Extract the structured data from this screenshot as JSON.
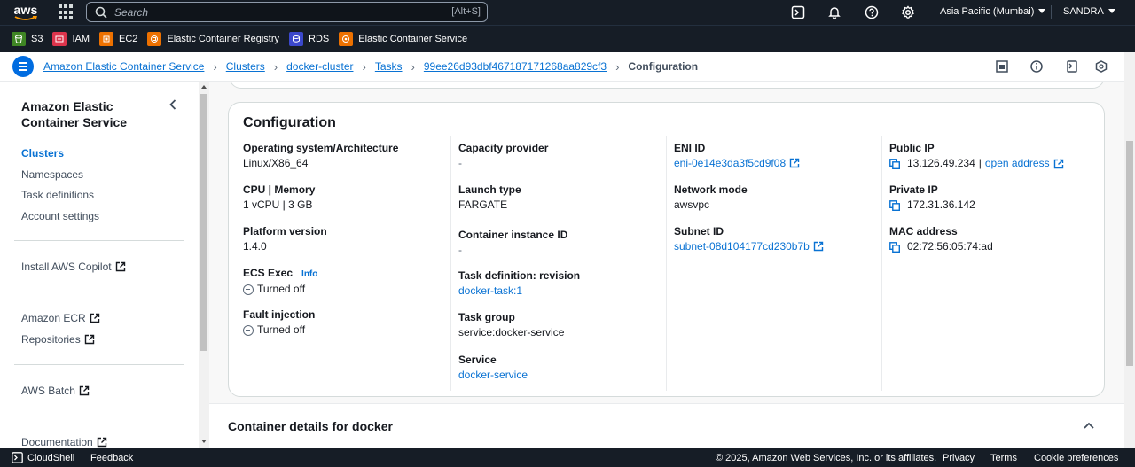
{
  "topnav": {
    "logo_text": "aws",
    "search_placeholder": "Search",
    "search_shortcut": "[Alt+S]",
    "region": "Asia Pacific (Mumbai)",
    "user": "SANDRA",
    "icons": [
      "cloudshell-icon",
      "bell-icon",
      "help-icon",
      "gear-icon"
    ]
  },
  "favorites": [
    {
      "label": "S3",
      "color": "#3f8624"
    },
    {
      "label": "IAM",
      "color": "#dd344c"
    },
    {
      "label": "EC2",
      "color": "#ed7100"
    },
    {
      "label": "Elastic Container Registry",
      "color": "#ed7100"
    },
    {
      "label": "RDS",
      "color": "#3b48cc"
    },
    {
      "label": "Elastic Container Service",
      "color": "#ed7100"
    }
  ],
  "breadcrumbs": {
    "items": [
      "Amazon Elastic Container Service",
      "Clusters",
      "docker-cluster",
      "Tasks",
      "99ee26d93dbf467187171268aa829cf3"
    ],
    "current": "Configuration"
  },
  "sidenav": {
    "title": "Amazon Elastic Container Service",
    "items": [
      "Clusters",
      "Namespaces",
      "Task definitions",
      "Account settings"
    ],
    "copilot": "Install AWS Copilot",
    "ecr": "Amazon ECR",
    "repositories": "Repositories",
    "batch": "AWS Batch",
    "documentation": "Documentation"
  },
  "configuration": {
    "title": "Configuration",
    "col1": {
      "os_label": "Operating system/Architecture",
      "os_value": "Linux/X86_64",
      "cpu_label": "CPU | Memory",
      "cpu_value": "1 vCPU | 3 GB",
      "platform_label": "Platform version",
      "platform_value": "1.4.0",
      "ecs_exec_label": "ECS Exec",
      "ecs_exec_info": "Info",
      "ecs_exec_value": "Turned off",
      "fault_label": "Fault injection",
      "fault_value": "Turned off"
    },
    "col2": {
      "capacity_label": "Capacity provider",
      "capacity_value": "-",
      "launch_label": "Launch type",
      "launch_value": "FARGATE",
      "instance_label": "Container instance ID",
      "instance_value": "-",
      "taskdef_label": "Task definition: revision",
      "taskdef_value": "docker-task:1",
      "group_label": "Task group",
      "group_value": "service:docker-service",
      "service_label": "Service",
      "service_value": "docker-service"
    },
    "col3": {
      "eni_label": "ENI ID",
      "eni_value": "eni-0e14e3da3f5cd9f08",
      "network_label": "Network mode",
      "network_value": "awsvpc",
      "subnet_label": "Subnet ID",
      "subnet_value": "subnet-08d104177cd230b7b"
    },
    "col4": {
      "public_ip_label": "Public IP",
      "public_ip_value": "13.126.49.234",
      "public_ip_sep": "|",
      "open_address": "open address",
      "private_ip_label": "Private IP",
      "private_ip_value": "172.31.36.142",
      "mac_label": "MAC address",
      "mac_value": "02:72:56:05:74:ad"
    }
  },
  "container_details": {
    "title": "Container details for docker"
  },
  "footer": {
    "cloudshell": "CloudShell",
    "feedback": "Feedback",
    "copyright": "© 2025, Amazon Web Services, Inc. or its affiliates.",
    "privacy": "Privacy",
    "terms": "Terms",
    "cookies": "Cookie preferences"
  }
}
